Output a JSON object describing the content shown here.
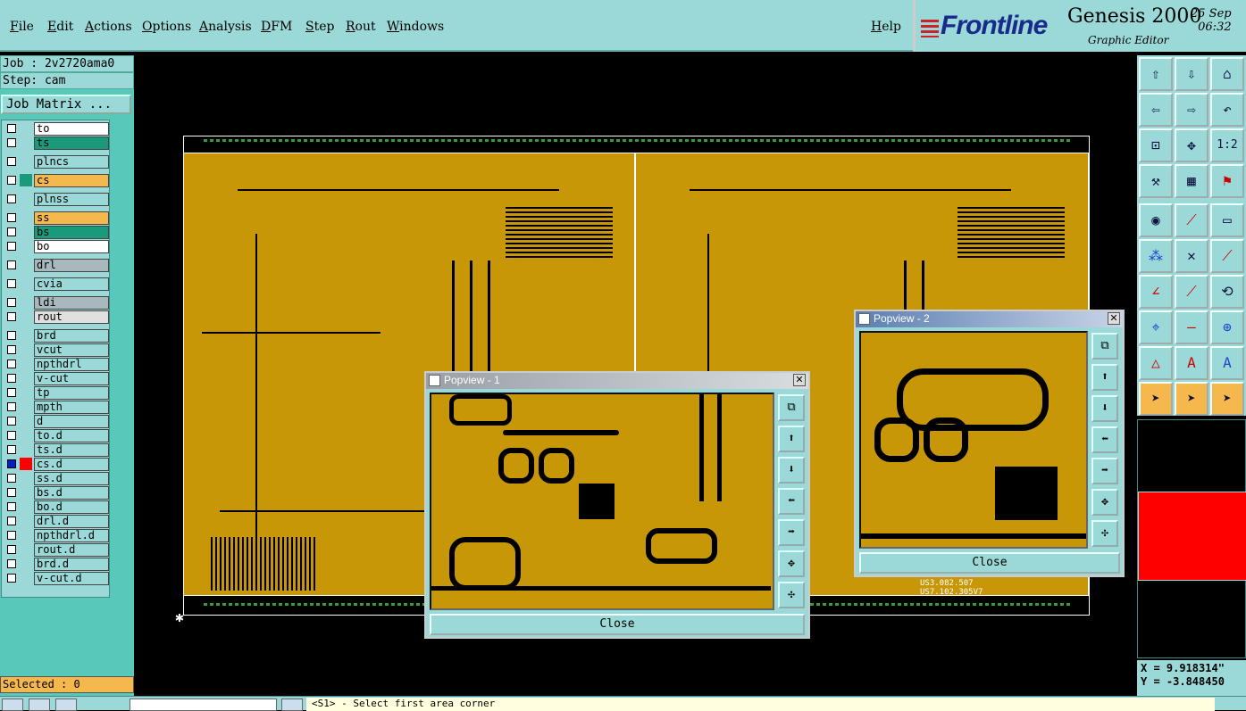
{
  "menu": {
    "items": [
      "File",
      "Edit",
      "Actions",
      "Options",
      "Analysis",
      "DFM",
      "Step",
      "Rout",
      "Windows"
    ],
    "help": "Help"
  },
  "brand": {
    "logo": "Frontline",
    "product": "Genesis 2000",
    "subtitle": "Graphic Editor",
    "date": "25 Sep",
    "time": "06:32"
  },
  "job": {
    "job_label": "Job : 2v2720ama0",
    "step_label": "Step: cam",
    "matrix_button": "Job Matrix ..."
  },
  "layers": [
    {
      "name": "to",
      "color": "#ffffff"
    },
    {
      "name": "ts",
      "color": "#1a9a7a"
    },
    {
      "name": "plncs",
      "color": "#9ad9d7"
    },
    {
      "name": "cs",
      "color": "#f5b84c",
      "active": true
    },
    {
      "name": "plnss",
      "color": "#9ad9d7"
    },
    {
      "name": "ss",
      "color": "#f5b84c"
    },
    {
      "name": "bs",
      "color": "#1a9a7a"
    },
    {
      "name": "bo",
      "color": "#ffffff"
    },
    {
      "name": "drl",
      "color": "#a8b8bc"
    },
    {
      "name": "cvia",
      "color": "#9ad9d7"
    },
    {
      "name": "ldi",
      "color": "#a8b8bc"
    },
    {
      "name": "rout",
      "color": "#e0e0e0"
    },
    {
      "name": "brd",
      "color": "#9ad9d7"
    },
    {
      "name": "vcut",
      "color": "#9ad9d7"
    },
    {
      "name": "npthdrl",
      "color": "#9ad9d7"
    },
    {
      "name": "v-cut",
      "color": "#9ad9d7"
    },
    {
      "name": "tp",
      "color": "#9ad9d7"
    },
    {
      "name": "mpth",
      "color": "#9ad9d7"
    },
    {
      "name": "d",
      "color": "#9ad9d7"
    },
    {
      "name": "to.d",
      "color": "#9ad9d7"
    },
    {
      "name": "ts.d",
      "color": "#9ad9d7"
    },
    {
      "name": "cs.d",
      "color": "#9ad9d7",
      "work": true
    },
    {
      "name": "ss.d",
      "color": "#9ad9d7"
    },
    {
      "name": "bs.d",
      "color": "#9ad9d7"
    },
    {
      "name": "bo.d",
      "color": "#9ad9d7"
    },
    {
      "name": "drl.d",
      "color": "#9ad9d7"
    },
    {
      "name": "npthdrl.d",
      "color": "#9ad9d7"
    },
    {
      "name": "rout.d",
      "color": "#9ad9d7"
    },
    {
      "name": "brd.d",
      "color": "#9ad9d7"
    },
    {
      "name": "v-cut.d",
      "color": "#9ad9d7"
    }
  ],
  "selected_label": "Selected : 0",
  "popview1": {
    "title": "Popview - 1",
    "close_label": "Close"
  },
  "popview2": {
    "title": "Popview - 2",
    "close_label": "Close"
  },
  "board_text": {
    "line1": "US3.082.507",
    "line2": "US7.102.305V7"
  },
  "coords": {
    "x": "X = 9.918314\"",
    "y": "Y = -3.848450"
  },
  "prompt": "<S1> - Select first area corner",
  "colors": {
    "board": "#c79708",
    "panel": "#9ad9d7",
    "accent": "#f5b84c",
    "highlight": "#ff0000"
  }
}
